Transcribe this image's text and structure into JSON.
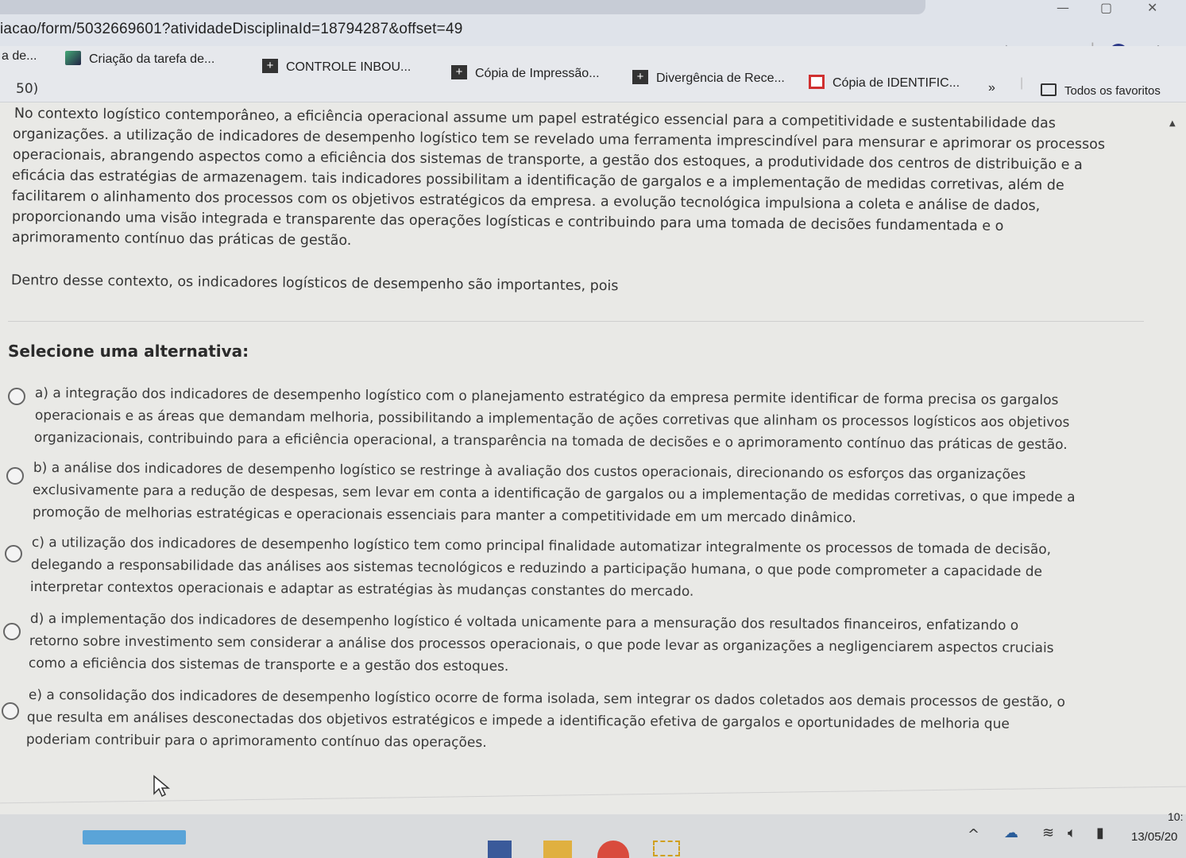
{
  "browser": {
    "url": "iacao/form/5032669601?atividadeDisciplinaId=18794287&offset=49",
    "bookmarks": [
      {
        "label": "a de...",
        "icon": "none"
      },
      {
        "label": "Criação da tarefa de...",
        "icon": "image-icon"
      },
      {
        "label": "CONTROLE INBOU...",
        "icon": "dark-plus-icon"
      },
      {
        "label": "Cópia de Impressão...",
        "icon": "dark-plus-icon"
      },
      {
        "label": "Divergência de Rece...",
        "icon": "dark-plus-icon"
      },
      {
        "label": "Cópia de IDENTIFIC...",
        "icon": "red-square-icon"
      }
    ],
    "more_bookmarks": "»",
    "all_favorites": "Todos os favoritos"
  },
  "question": {
    "number": "50)",
    "paragraph_lines": [
      "No contexto logístico contemporâneo, a eficiência operacional assume um papel estratégico essencial para a competitividade e sustentabilidade das",
      "organizações. a utilização de indicadores de desempenho logístico tem se revelado uma ferramenta imprescindível para mensurar e aprimorar os processos",
      "operacionais, abrangendo aspectos como a eficiência dos sistemas de transporte, a gestão dos estoques, a produtividade dos centros de distribuição e a",
      "eficácia das estratégias de armazenagem. tais indicadores possibilitam a identificação de gargalos e a implementação de medidas corretivas, além de",
      "facilitarem o alinhamento dos processos com os objetivos estratégicos da empresa. a evolução tecnológica impulsiona a coleta e análise de dados,",
      "proporcionando uma visão integrada e transparente das operações logísticas e contribuindo para uma tomada de decisões fundamentada e o",
      "aprimoramento contínuo das práticas de gestão."
    ],
    "prompt": "Dentro desse contexto, os indicadores logísticos de desempenho são importantes, pois",
    "select_label": "Selecione uma alternativa:",
    "options": [
      {
        "lines": [
          "a) a integração dos indicadores de desempenho logístico com o planejamento estratégico da empresa permite identificar de forma precisa os gargalos",
          "operacionais e as áreas que demandam melhoria, possibilitando a implementação de ações corretivas que alinham os processos logísticos aos objetivos",
          "organizacionais, contribuindo para a eficiência operacional, a transparência na tomada de decisões e o aprimoramento contínuo das práticas de gestão."
        ]
      },
      {
        "lines": [
          "b) a análise dos indicadores de desempenho logístico se restringe à avaliação dos custos operacionais, direcionando os esforços das organizações",
          "exclusivamente para a redução de despesas, sem levar em conta a identificação de gargalos ou a implementação de medidas corretivas, o que impede a",
          "promoção de melhorias estratégicas e operacionais essenciais para manter a competitividade em um mercado dinâmico."
        ]
      },
      {
        "lines": [
          "c) a utilização dos indicadores de desempenho logístico tem como principal finalidade automatizar integralmente os processos de tomada de decisão,",
          "delegando a responsabilidade das análises aos sistemas tecnológicos e reduzindo a participação humana, o que pode comprometer a capacidade de",
          "interpretar contextos operacionais e adaptar as estratégias às mudanças constantes do mercado."
        ]
      },
      {
        "lines": [
          "d) a implementação dos indicadores de desempenho logístico é voltada unicamente para a mensuração dos resultados financeiros, enfatizando o",
          "retorno sobre investimento sem considerar a análise dos processos operacionais, o que pode levar as organizações a negligenciarem aspectos cruciais",
          "como a eficiência dos sistemas de transporte e a gestão dos estoques."
        ]
      },
      {
        "lines": [
          "e) a consolidação dos indicadores de desempenho logístico ocorre de forma isolada, sem integrar os dados coletados aos demais processos de gestão, o",
          "que resulta em análises desconectadas dos objetivos estratégicos e impede a identificação efetiva de gargalos e oportunidades de melhoria que",
          "poderiam contribuir para o aprimoramento contínuo das operações."
        ]
      }
    ]
  },
  "taskbar": {
    "time": "10:",
    "date": "13/05/20"
  }
}
